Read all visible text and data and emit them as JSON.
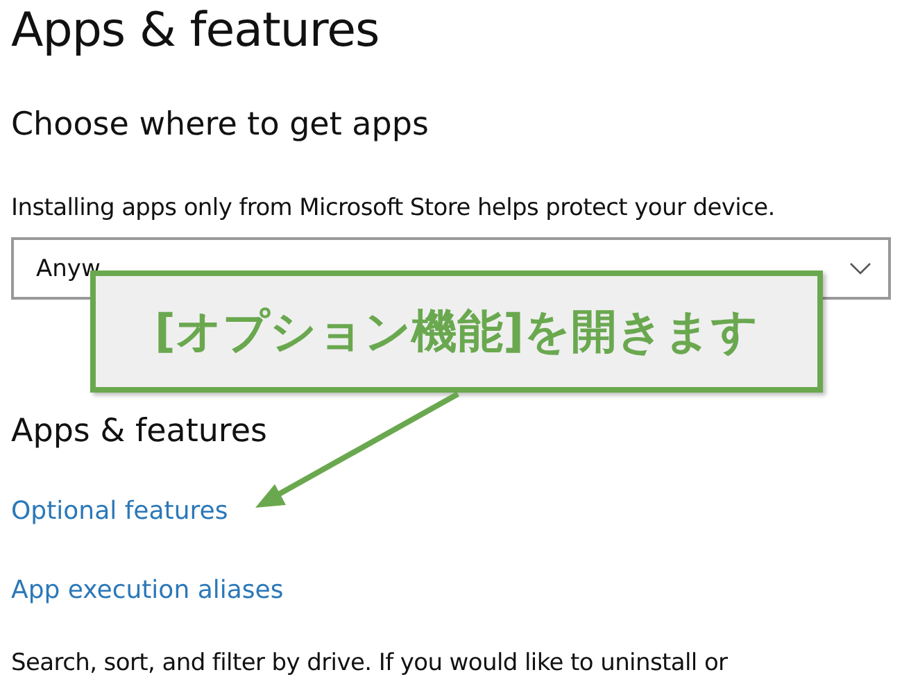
{
  "page": {
    "title": "Apps & features"
  },
  "install_section": {
    "heading": "Choose where to get apps",
    "description": "Installing apps only from Microsoft Store helps protect your device.",
    "dropdown": {
      "value": "Anyw"
    }
  },
  "apps_section": {
    "heading": "Apps & features",
    "links": [
      "Optional features",
      "App execution aliases"
    ],
    "description": "Search, sort, and filter by drive. If you would like to uninstall or"
  },
  "callout": {
    "text": "[オプション機能]を開きます"
  }
}
